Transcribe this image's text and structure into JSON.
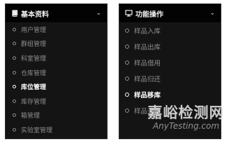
{
  "left_menu": {
    "header": {
      "title": "基本资料",
      "icon": "book-icon"
    },
    "items": [
      {
        "label": "用户管理",
        "active": false
      },
      {
        "label": "群组管理",
        "active": false
      },
      {
        "label": "科室管理",
        "active": false
      },
      {
        "label": "仓库管理",
        "active": false
      },
      {
        "label": "库位管理",
        "active": true
      },
      {
        "label": "库存管理",
        "active": false
      },
      {
        "label": "箱管理",
        "active": false
      },
      {
        "label": "实验室管理",
        "active": false
      }
    ]
  },
  "right_menu": {
    "header": {
      "title": "功能操作",
      "icon": "monitor-icon"
    },
    "items": [
      {
        "label": "样品入库",
        "active": false
      },
      {
        "label": "样品出库",
        "active": false
      },
      {
        "label": "样品借用",
        "active": false
      },
      {
        "label": "样品归还",
        "active": false
      },
      {
        "label": "样品移库",
        "active": true
      },
      {
        "label": "样品查询",
        "active": false
      }
    ]
  },
  "watermark": {
    "title": "嘉峪检测网",
    "subtitle": "AnyTesting.com"
  },
  "colors": {
    "panel_bg": "#141414",
    "header_bg": "#030303",
    "item_text": "#8e8e8e",
    "active_text": "#ffffff"
  }
}
